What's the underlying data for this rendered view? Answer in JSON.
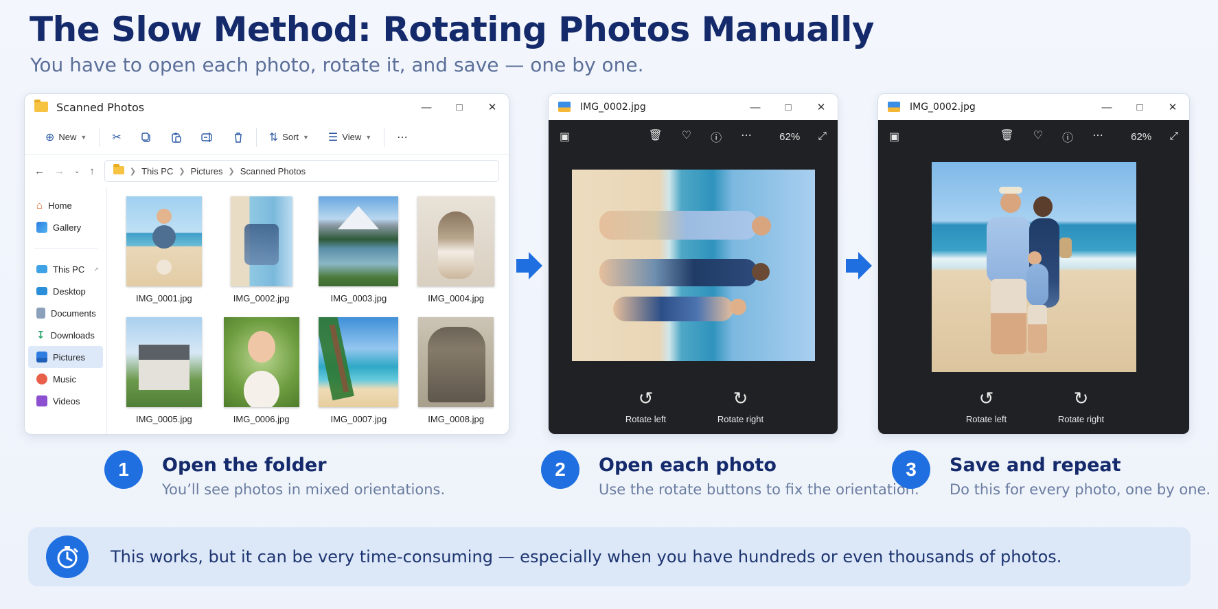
{
  "header": {
    "title": "The Slow Method: Rotating Photos Manually",
    "subtitle": "You have to open each photo, rotate it, and save — one by one."
  },
  "explorer": {
    "title": "Scanned Photos",
    "toolbar": {
      "new_label": "New",
      "sort_label": "Sort",
      "view_label": "View",
      "icons": [
        "cut-icon",
        "copy-icon",
        "paste-icon",
        "rename-icon",
        "delete-icon",
        "more-icon"
      ]
    },
    "breadcrumb": [
      "This PC",
      "Pictures",
      "Scanned Photos"
    ],
    "nav": {
      "home": "Home",
      "gallery": "Gallery",
      "this_pc": "This PC",
      "desktop": "Desktop",
      "documents": "Documents",
      "downloads": "Downloads",
      "pictures": "Pictures",
      "music": "Music",
      "videos": "Videos"
    },
    "files": [
      "IMG_0001.jpg",
      "IMG_0002.jpg",
      "IMG_0003.jpg",
      "IMG_0004.jpg",
      "IMG_0005.jpg",
      "IMG_0006.jpg",
      "IMG_0007.jpg",
      "IMG_0008.jpg"
    ]
  },
  "viewer1": {
    "title": "IMG_0002.jpg",
    "zoom": "62%",
    "rotate_left": "Rotate left",
    "rotate_right": "Rotate right"
  },
  "viewer2": {
    "title": "IMG_0002.jpg",
    "zoom": "62%",
    "rotate_left": "Rotate left",
    "rotate_right": "Rotate right"
  },
  "steps": [
    {
      "num": "1",
      "title": "Open the folder",
      "desc": "You’ll see photos in mixed orientations."
    },
    {
      "num": "2",
      "title": "Open each photo",
      "desc": "Use the rotate buttons to fix the orientation."
    },
    {
      "num": "3",
      "title": "Save and repeat",
      "desc": "Do this for every photo, one by one."
    }
  ],
  "note": {
    "text": "This works, but it can be very time-consuming — especially when you have hundreds or even thousands of photos."
  },
  "colors": {
    "accent": "#1f6fe0",
    "title": "#142a6b",
    "note_bg": "#dce7f8",
    "viewer_bg": "#202124"
  }
}
